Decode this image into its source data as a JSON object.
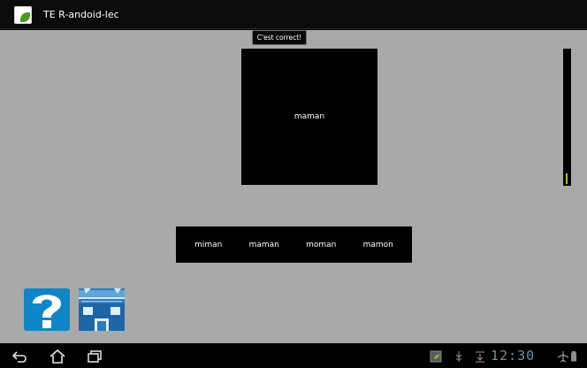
{
  "app": {
    "title": "TE R-andoid-lec"
  },
  "toast": {
    "text": "C'est correct!"
  },
  "card": {
    "word": "maman"
  },
  "level": {
    "fraction": 0.08,
    "color": "#9fcc20"
  },
  "choices": [
    "miman",
    "maman",
    "moman",
    "mamon"
  ],
  "buttons": {
    "help_icon": "question-mark-icon",
    "home_icon": "house-icon"
  },
  "status": {
    "time": "12:30"
  },
  "colors": {
    "background": "#a9a9a9",
    "help_blue": "#0e86c7",
    "home_blue": "#1a6fb5"
  }
}
